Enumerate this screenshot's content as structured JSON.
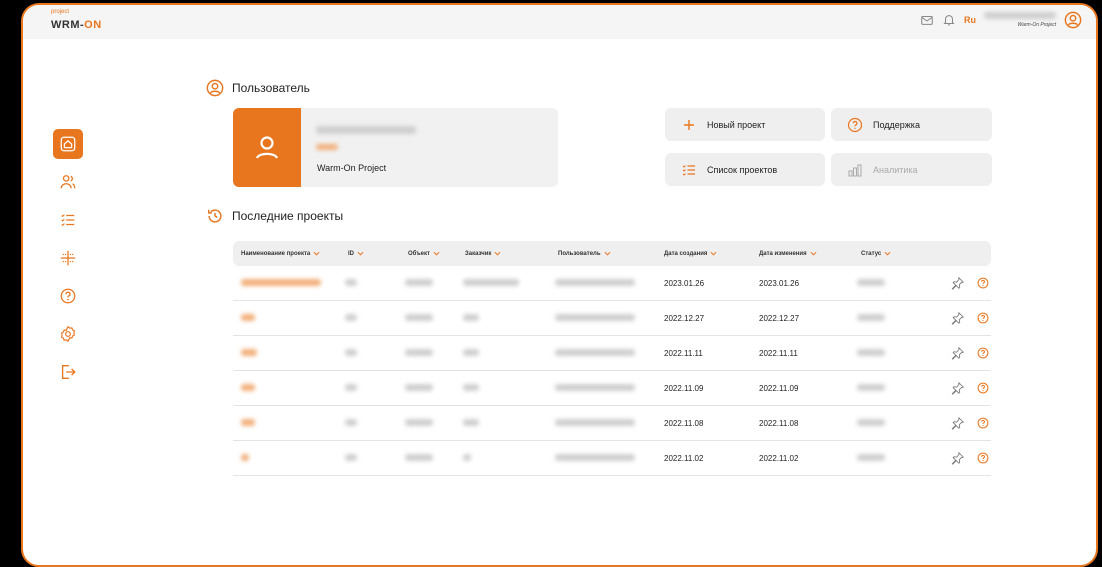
{
  "brand": {
    "small": "project",
    "name_a": "W",
    "name_b": "RM-",
    "name_c": "ON"
  },
  "header": {
    "lang": "Ru",
    "user_caption": "Warm-On Project",
    "accent": "#e8761f"
  },
  "sidebar": {
    "items": [
      {
        "icon": "home-icon",
        "active": true
      },
      {
        "icon": "users-icon"
      },
      {
        "icon": "list-icon"
      },
      {
        "icon": "grid-icon"
      },
      {
        "icon": "help-icon"
      },
      {
        "icon": "settings-icon"
      },
      {
        "icon": "logout-icon"
      }
    ]
  },
  "user_section": {
    "title": "Пользователь",
    "project": "Warm-On Project"
  },
  "actions": {
    "new_project": "Новый проект",
    "support": "Поддержка",
    "project_list": "Список проектов",
    "analytics": "Аналитика"
  },
  "recent": {
    "title": "Последние проекты",
    "columns": [
      "Наименование проекта",
      "ID",
      "Объект",
      "Заказчик",
      "Пользователь",
      "Дата создания",
      "Дата изменения",
      "Статус"
    ],
    "rows": [
      {
        "created": "2023.01.26",
        "modified": "2023.01.26"
      },
      {
        "created": "2022.12.27",
        "modified": "2022.12.27"
      },
      {
        "created": "2022.11.11",
        "modified": "2022.11.11"
      },
      {
        "created": "2022.11.09",
        "modified": "2022.11.09"
      },
      {
        "created": "2022.11.08",
        "modified": "2022.11.08"
      },
      {
        "created": "2022.11.02",
        "modified": "2022.11.02"
      }
    ]
  }
}
